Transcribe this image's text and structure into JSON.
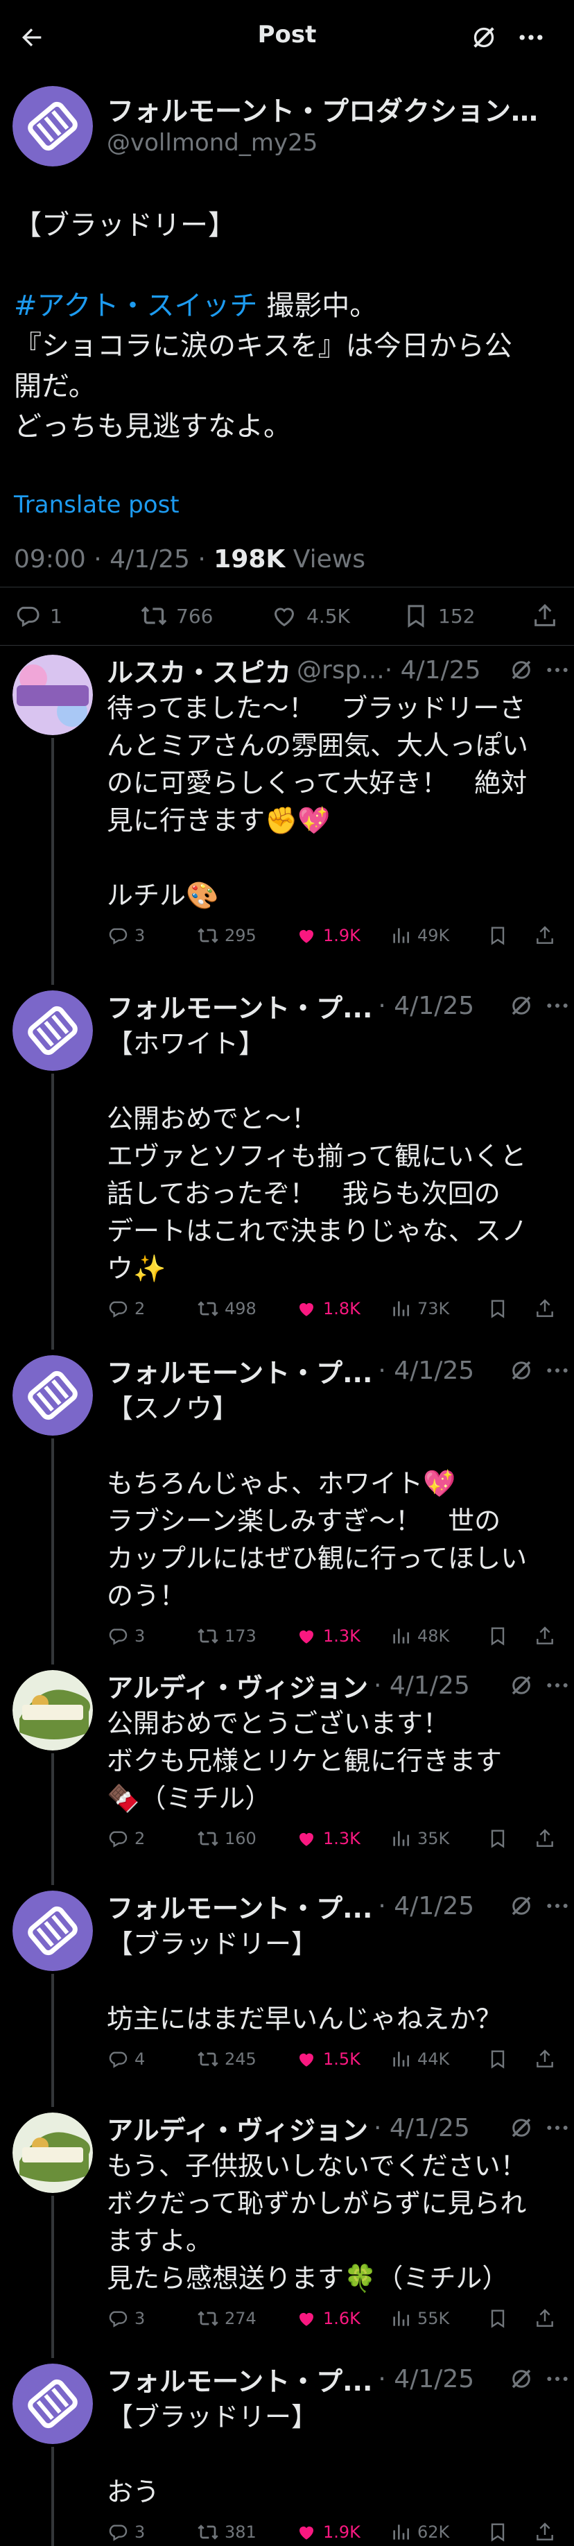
{
  "header": {
    "title": "Post"
  },
  "colors": {
    "link": "#1d9bf0",
    "like": "#f91880",
    "muted": "#71767b",
    "avatar_bg": "#7b67c9"
  },
  "icons": {
    "back": "back-arrow-icon",
    "grok": "grok-icon",
    "more": "more-dots-icon",
    "reply": "reply-bubble-icon",
    "repost": "repost-arrows-icon",
    "like": "heart-icon",
    "bookmark": "bookmark-icon",
    "share": "share-icon",
    "views": "views-bars-icon"
  },
  "main_post": {
    "author_name": "フォルモーント・プロダクション…",
    "handle": "@vollmond_my25",
    "lines": [
      "【ブラッドリー】",
      "",
      "撮影中。",
      "『ショコラに涙のキスを』は今日から公",
      "開だ。",
      "どっちも見逃すなよ。"
    ],
    "hashtag": "#アクト・スイッチ",
    "translate": "Translate post",
    "time": "09:00 · 4/1/25 · ",
    "views_count": "198K",
    "views_label": " Views",
    "stats": {
      "replies": "1",
      "reposts": "766",
      "likes": "4.5K",
      "bookmarks": "152"
    }
  },
  "replies": [
    {
      "name": "ルスカ・スピカ",
      "handle": "@rsp...",
      "date": "· 4/1/25",
      "avatar": "pink",
      "avatar_text": "RUSKA SPICA",
      "lines": [
        "待ってました〜！　ブラッドリーさ",
        "んとミアさんの雰囲気、大人っぽい",
        "のに可愛らしくって大好き！　絶対",
        "見に行きます✊💖",
        "",
        "ルチル🎨"
      ],
      "stats": {
        "replies": "3",
        "reposts": "295",
        "likes": "1.9K",
        "views": "49K"
      }
    },
    {
      "name": "フォルモーント・プ...",
      "handle": "",
      "date": "· 4/1/25",
      "avatar": "purple",
      "lines": [
        "【ホワイト】",
        "",
        "公開おめでと〜！",
        "エヴァとソフィも揃って観にいくと",
        "話しておったぞ！　我らも次回の",
        "デートはこれで決まりじゃな、スノ",
        "ウ✨"
      ],
      "stats": {
        "replies": "2",
        "reposts": "498",
        "likes": "1.8K",
        "views": "73K"
      }
    },
    {
      "name": "フォルモーント・プ...",
      "handle": "",
      "date": "· 4/1/25",
      "avatar": "purple",
      "lines": [
        "【スノウ】",
        "",
        "もちろんじゃよ、ホワイト💖",
        "ラブシーン楽しみすぎ〜！　世の",
        "カップルにはぜひ観に行ってほしい",
        "のう！"
      ],
      "stats": {
        "replies": "3",
        "reposts": "173",
        "likes": "1.3K",
        "views": "48K"
      }
    },
    {
      "name": "アルディ・ヴィジョン",
      "handle": "",
      "date": "· 4/1/25",
      "avatar": "green",
      "avatar_text": "ARDI VISION",
      "lines": [
        "公開おめでとうございます！",
        "ボクも兄様とリケと観に行きます",
        "🍫（ミチル）"
      ],
      "stats": {
        "replies": "2",
        "reposts": "160",
        "likes": "1.3K",
        "views": "35K"
      }
    },
    {
      "name": "フォルモーント・プ...",
      "handle": "",
      "date": "· 4/1/25",
      "avatar": "purple",
      "lines": [
        "【ブラッドリー】",
        "",
        "坊主にはまだ早いんじゃねえか？"
      ],
      "stats": {
        "replies": "4",
        "reposts": "245",
        "likes": "1.5K",
        "views": "44K"
      }
    },
    {
      "name": "アルディ・ヴィジョン",
      "handle": "",
      "date": "· 4/1/25",
      "avatar": "green",
      "avatar_text": "ARDI VISION",
      "lines": [
        "もう、子供扱いしないでください！",
        "ボクだって恥ずかしがらずに見られ",
        "ますよ。",
        "見たら感想送ります🍀（ミチル）"
      ],
      "stats": {
        "replies": "3",
        "reposts": "274",
        "likes": "1.6K",
        "views": "55K"
      }
    },
    {
      "name": "フォルモーント・プ...",
      "handle": "",
      "date": "· 4/1/25",
      "avatar": "purple",
      "lines": [
        "【ブラッドリー】",
        "",
        "おう"
      ],
      "stats": {
        "replies": "3",
        "reposts": "381",
        "likes": "1.9K",
        "views": "62K"
      }
    }
  ]
}
